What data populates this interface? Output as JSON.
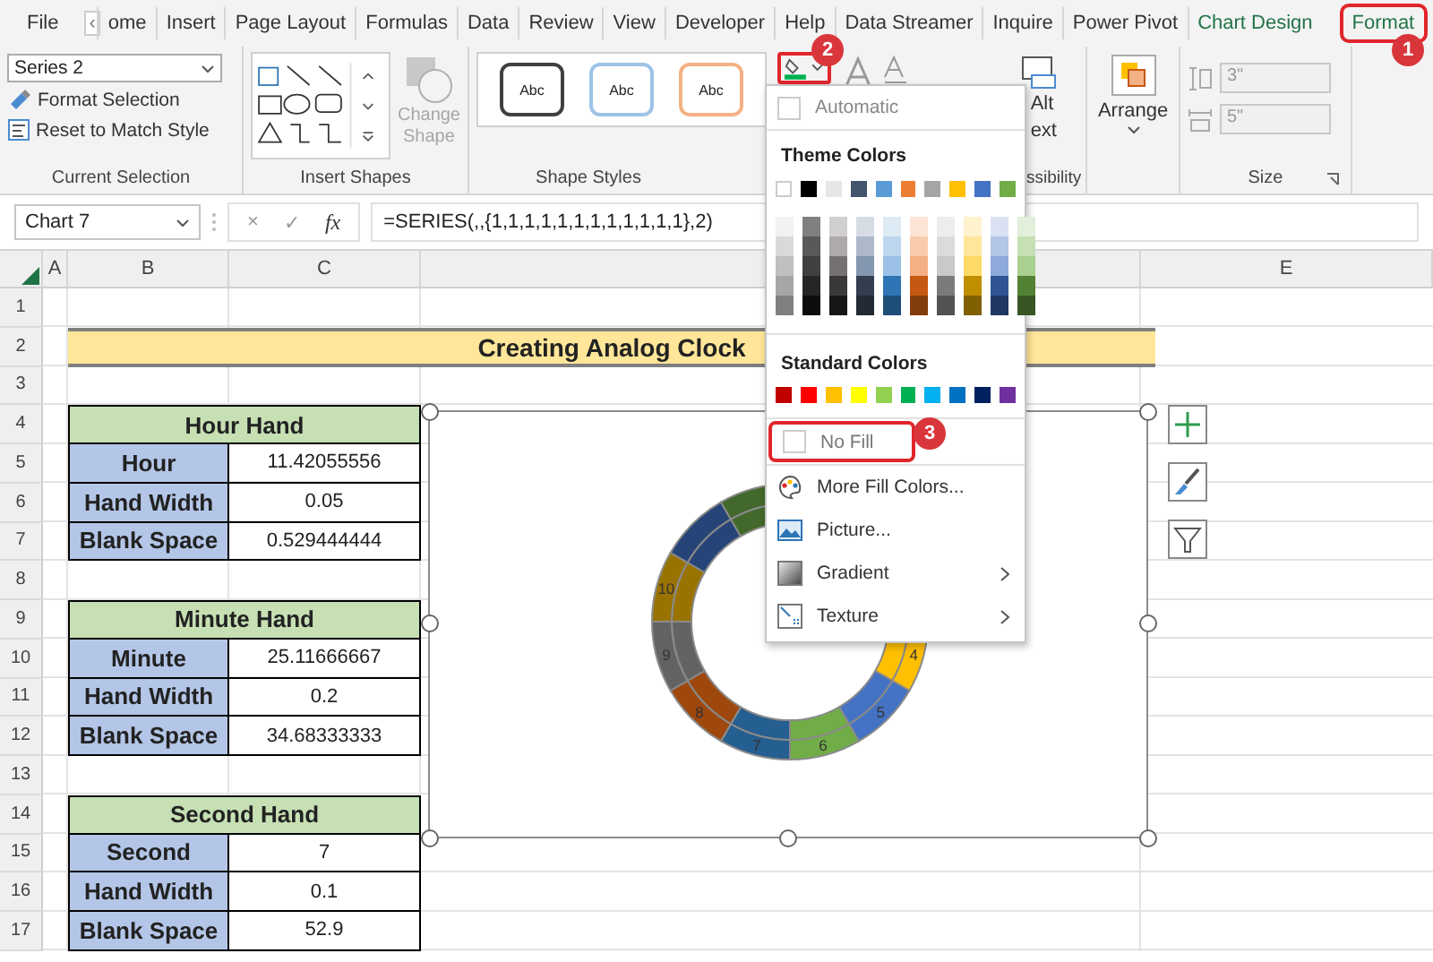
{
  "tabs": [
    {
      "label": "File",
      "selected": false
    },
    {
      "label": "ome",
      "selected": false
    },
    {
      "label": "Insert",
      "selected": false
    },
    {
      "label": "Page Layout",
      "selected": false
    },
    {
      "label": "Formulas",
      "selected": false
    },
    {
      "label": "Data",
      "selected": false
    },
    {
      "label": "Review",
      "selected": false
    },
    {
      "label": "View",
      "selected": false
    },
    {
      "label": "Developer",
      "selected": false
    },
    {
      "label": "Help",
      "selected": false
    },
    {
      "label": "Data Streamer",
      "selected": false
    },
    {
      "label": "Inquire",
      "selected": false
    },
    {
      "label": "Power Pivot",
      "selected": false
    },
    {
      "label": "Chart Design",
      "selected": false
    },
    {
      "label": "Format",
      "selected": true
    }
  ],
  "tab_scroll": "‹",
  "ribbon": {
    "current_selection": {
      "dropdown": "Series 2",
      "buttons": [
        "Format Selection",
        "Reset to Match Style"
      ],
      "label": "Current Selection"
    },
    "insert_shapes": {
      "change_shape": "Change Shape",
      "disabled": true,
      "label": "Insert Shapes"
    },
    "shape_styles": {
      "presets": [
        {
          "text": "Abc",
          "color": "#404040"
        },
        {
          "text": "Abc",
          "color": "#9dc3e6"
        },
        {
          "text": "Abc",
          "color": "#f4b183"
        }
      ],
      "label": "Shape Styles"
    },
    "alt_text": {
      "line_1": "Alt",
      "line_2": "ext"
    },
    "accessibility_label": "ssibility",
    "arrange": "Arrange",
    "size": {
      "height": "3\"",
      "width": "5\"",
      "disabled": true,
      "label": "Size"
    }
  },
  "badges": [
    "1",
    "2",
    "3"
  ],
  "formula_bar": {
    "name_box": "Chart 7",
    "cancel": "×",
    "enter": "✓",
    "function": "fx",
    "formula": "=SERIES(,,{1,1,1,1,1,1,1,1,1,1,1,1},2)"
  },
  "column_headers": [
    "A",
    "B",
    "C",
    "E"
  ],
  "row_numbers": [
    "1",
    "2",
    "3",
    "4",
    "5",
    "6",
    "7",
    "8",
    "9",
    "10",
    "11",
    "12",
    "13",
    "14",
    "15",
    "16",
    "17"
  ],
  "title": "Creating Analog Clock",
  "tables": [
    {
      "title": "Hour Hand",
      "rows": [
        {
          "label": "Hour",
          "value": "11.42055556"
        },
        {
          "label": "Hand Width",
          "value": "0.05"
        },
        {
          "label": "Blank Space",
          "value": "0.529444444"
        }
      ]
    },
    {
      "title": "Minute Hand",
      "rows": [
        {
          "label": "Minute",
          "value": "25.11666667"
        },
        {
          "label": "Hand Width",
          "value": "0.2"
        },
        {
          "label": "Blank Space",
          "value": "34.68333333"
        }
      ]
    },
    {
      "title": "Second Hand",
      "rows": [
        {
          "label": "Second",
          "value": "7"
        },
        {
          "label": "Hand Width",
          "value": "0.1"
        },
        {
          "label": "Blank Space",
          "value": "52.9"
        }
      ]
    }
  ],
  "clock_chart": {
    "segments": [
      {
        "color": "#ffc000",
        "label": "4"
      },
      {
        "color": "#4472c4",
        "label": "5"
      },
      {
        "color": "#70ad47",
        "label": "6"
      },
      {
        "color": "#255e91",
        "label": "7"
      },
      {
        "color": "#9e480e",
        "label": "8"
      },
      {
        "color": "#636363",
        "label": "9"
      },
      {
        "color": "#997300",
        "label": "10"
      },
      {
        "color": "#264478"
      },
      {
        "color": "#43682b"
      }
    ]
  },
  "fill_menu": {
    "automatic": "Automatic",
    "theme_heading": "Theme Colors",
    "theme_colors": [
      {
        "color": "#ffffff",
        "shades": [
          {
            "color": "#f2f2f2"
          },
          {
            "color": "#d9d9d9"
          },
          {
            "color": "#bfbfbf"
          },
          {
            "color": "#a6a6a6"
          },
          {
            "color": "#808080"
          }
        ]
      },
      {
        "color": "#000000",
        "shades": [
          {
            "color": "#808080"
          },
          {
            "color": "#595959"
          },
          {
            "color": "#404040"
          },
          {
            "color": "#262626"
          },
          {
            "color": "#0d0d0d"
          }
        ]
      },
      {
        "color": "#e7e6e6",
        "shades": [
          {
            "color": "#d0cece"
          },
          {
            "color": "#aeaaaa"
          },
          {
            "color": "#757171"
          },
          {
            "color": "#3a3838"
          },
          {
            "color": "#171616"
          }
        ]
      },
      {
        "color": "#44546a",
        "shades": [
          {
            "color": "#d6dce4"
          },
          {
            "color": "#adb9ca"
          },
          {
            "color": "#8497b0"
          },
          {
            "color": "#333f4f"
          },
          {
            "color": "#222a35"
          }
        ]
      },
      {
        "color": "#5b9bd5",
        "shades": [
          {
            "color": "#ddebf7"
          },
          {
            "color": "#bdd7ee"
          },
          {
            "color": "#9bc2e6"
          },
          {
            "color": "#2f75b5"
          },
          {
            "color": "#1f4e78"
          }
        ]
      },
      {
        "color": "#ed7d31",
        "shades": [
          {
            "color": "#fce4d6"
          },
          {
            "color": "#f8cbad"
          },
          {
            "color": "#f4b084"
          },
          {
            "color": "#c65911"
          },
          {
            "color": "#833c0c"
          }
        ]
      },
      {
        "color": "#a5a5a5",
        "shades": [
          {
            "color": "#ededed"
          },
          {
            "color": "#dbdbdb"
          },
          {
            "color": "#c9c9c9"
          },
          {
            "color": "#7b7b7b"
          },
          {
            "color": "#525252"
          }
        ]
      },
      {
        "color": "#ffc000",
        "shades": [
          {
            "color": "#fff2cc"
          },
          {
            "color": "#ffe699"
          },
          {
            "color": "#ffd966"
          },
          {
            "color": "#bf8f00"
          },
          {
            "color": "#806000"
          }
        ]
      },
      {
        "color": "#4472c4",
        "shades": [
          {
            "color": "#d9e1f2"
          },
          {
            "color": "#b4c6e7"
          },
          {
            "color": "#8ea9db"
          },
          {
            "color": "#305496"
          },
          {
            "color": "#203764"
          }
        ]
      },
      {
        "color": "#70ad47",
        "shades": [
          {
            "color": "#e2efda"
          },
          {
            "color": "#c6e0b4"
          },
          {
            "color": "#a9d08e"
          },
          {
            "color": "#548235"
          },
          {
            "color": "#375623"
          }
        ]
      }
    ],
    "standard_heading": "Standard Colors",
    "standard_colors": [
      {
        "color": "#c00000"
      },
      {
        "color": "#ff0000"
      },
      {
        "color": "#ffc000"
      },
      {
        "color": "#ffff00"
      },
      {
        "color": "#92d050"
      },
      {
        "color": "#00b050"
      },
      {
        "color": "#00b0f0"
      },
      {
        "color": "#0070c0"
      },
      {
        "color": "#002060"
      },
      {
        "color": "#7030a0"
      }
    ],
    "items": [
      {
        "kind": "nofill",
        "label": "No Fill",
        "highlighted": true
      },
      {
        "kind": "palette",
        "label": "More Fill Colors..."
      },
      {
        "kind": "picture",
        "label": "Picture..."
      },
      {
        "kind": "gradient",
        "label": "Gradient",
        "submenu": true
      },
      {
        "kind": "texture",
        "label": "Texture",
        "submenu": true
      }
    ]
  }
}
